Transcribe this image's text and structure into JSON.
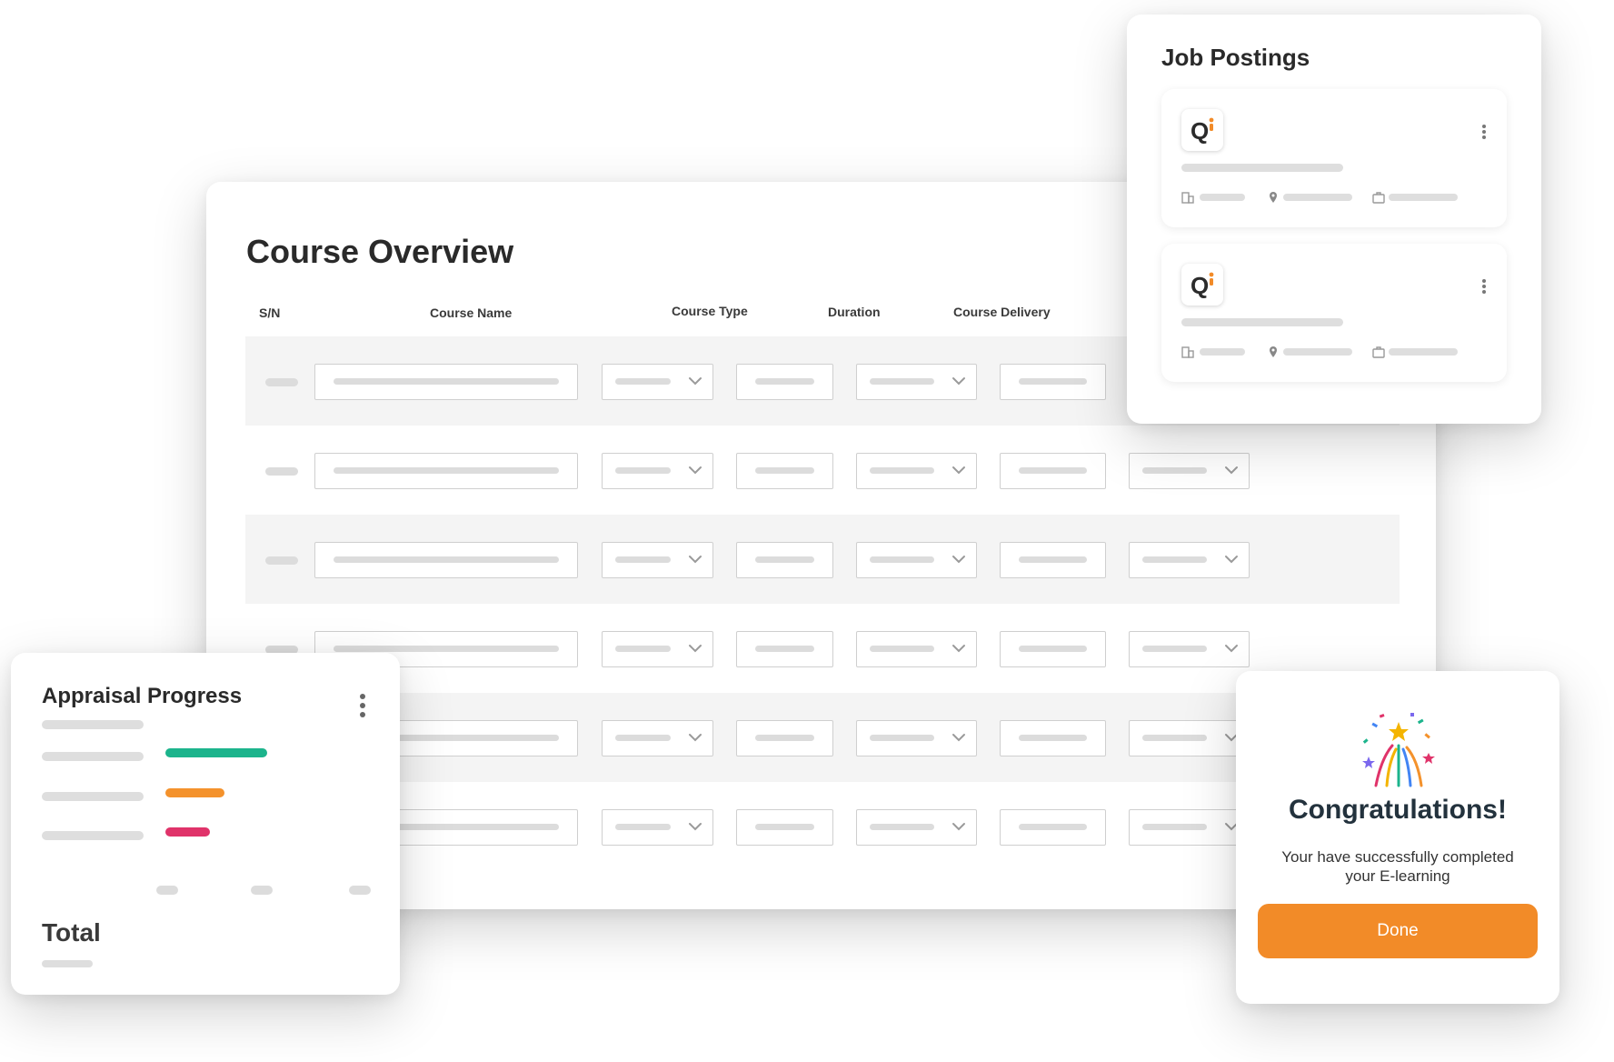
{
  "course_overview": {
    "title": "Course Overview",
    "columns": [
      "S/N",
      "Course Name",
      "Course Type",
      "Duration",
      "Course Delivery"
    ]
  },
  "job_postings": {
    "title": "Job Postings",
    "cards": [
      {
        "logo_letter": "Q"
      },
      {
        "logo_letter": "Q"
      }
    ]
  },
  "appraisal": {
    "title": "Appraisal Progress",
    "total_label": "Total",
    "bars": [
      {
        "color": "#1cb48c",
        "fraction": 1.0
      },
      {
        "color": "#f4922c",
        "fraction": 0.58
      },
      {
        "color": "#e0336a",
        "fraction": 0.44
      }
    ]
  },
  "congratulations": {
    "title": "Congratulations!",
    "message": "Your have successfully completed your E-learning",
    "button_label": "Done",
    "accent_color": "#f28b28"
  }
}
